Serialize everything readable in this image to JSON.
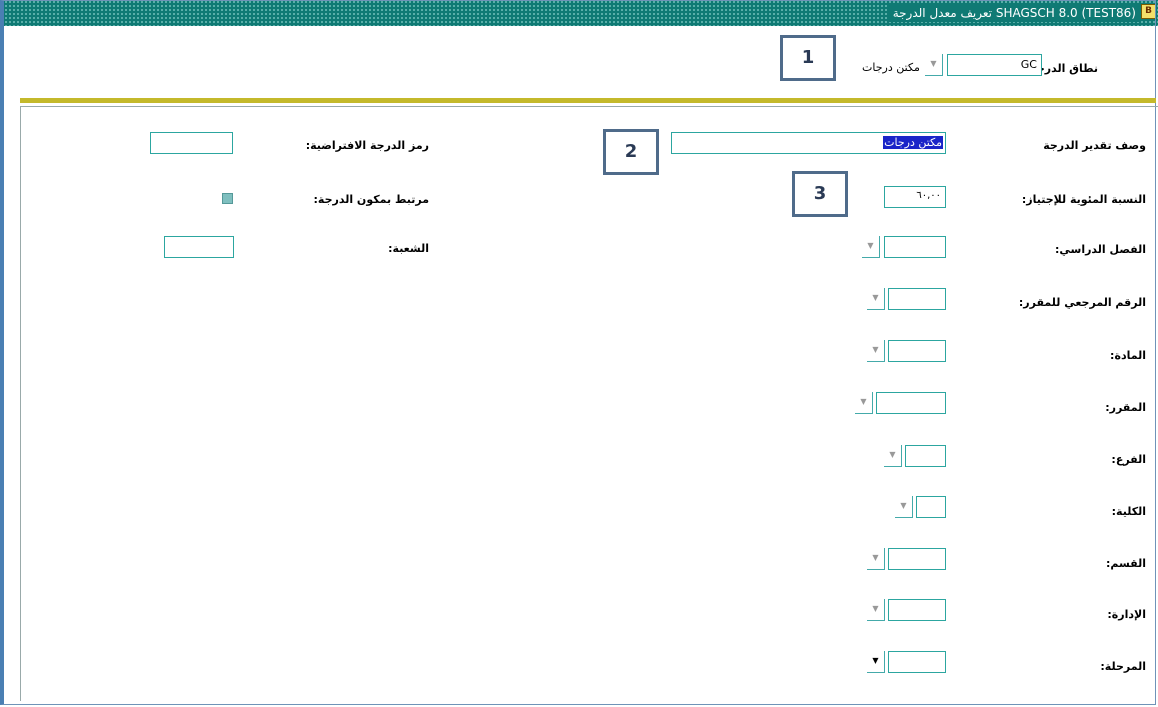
{
  "window": {
    "title": "تعريف معدل الدرجة  SHAGSCH  8.0  (TEST86)"
  },
  "header": {
    "grade_scope_label": "نطاق الدرجة:",
    "grade_scope_value": "GC",
    "grade_scope_desc": "مكتن درجات"
  },
  "callouts": [
    "1",
    "2",
    "3"
  ],
  "form": {
    "grade_desc_label": "وصف تقدير الدرجة",
    "grade_desc_value": "مكتن درجات",
    "pass_pct_label": "النسبة المئوية للإجتياز:",
    "pass_pct_value": "٦٠,٠٠",
    "term_label": "الفصل الدراسي:",
    "course_ref_label": "الرقم المرجعي للمقرر:",
    "subject_label": "المادة:",
    "course_label": "المقرر:",
    "branch_label": "الفرع:",
    "college_label": "الكلية:",
    "dept_label": "القسم:",
    "division_label": "الإدارة:",
    "level_label": "المرحلة:",
    "default_grade_label": "رمز الدرجة الافتراضية:",
    "linked_component_label": "مرتبط بمكون الدرجة:",
    "section_label": "الشعبة:"
  },
  "icons": {
    "dropdown": "▼",
    "app": "app-logo-icon"
  }
}
